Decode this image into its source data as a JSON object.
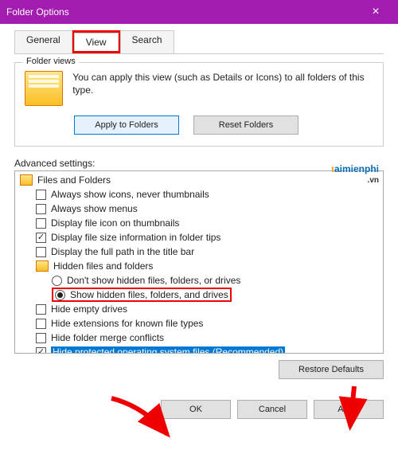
{
  "window": {
    "title": "Folder Options"
  },
  "tabs": {
    "general": "General",
    "view": "View",
    "search": "Search"
  },
  "folderViews": {
    "legend": "Folder views",
    "text": "You can apply this view (such as Details or Icons) to all folders of this type.",
    "applyBtn": "Apply to Folders",
    "resetBtn": "Reset Folders"
  },
  "advanced": {
    "label": "Advanced settings:",
    "root": "Files and Folders",
    "items": [
      {
        "label": "Always show icons, never thumbnails",
        "checked": false
      },
      {
        "label": "Always show menus",
        "checked": false
      },
      {
        "label": "Display file icon on thumbnails",
        "checked": false
      },
      {
        "label": "Display file size information in folder tips",
        "checked": true
      },
      {
        "label": "Display the full path in the title bar",
        "checked": false
      }
    ],
    "hiddenGroup": "Hidden files and folders",
    "radios": [
      {
        "label": "Don't show hidden files, folders, or drives",
        "selected": false
      },
      {
        "label": "Show hidden files, folders, and drives",
        "selected": true
      }
    ],
    "items2": [
      {
        "label": "Hide empty drives",
        "checked": false
      },
      {
        "label": "Hide extensions for known file types",
        "checked": false
      },
      {
        "label": "Hide folder merge conflicts",
        "checked": false
      },
      {
        "label": "Hide protected operating system files (Recommended)",
        "checked": true,
        "highlighted": true
      }
    ],
    "restoreBtn": "Restore Defaults"
  },
  "buttons": {
    "ok": "OK",
    "cancel": "Cancel",
    "apply": "Apply"
  },
  "watermark": {
    "brand": "aimienphi",
    "suffix": ".vn"
  }
}
